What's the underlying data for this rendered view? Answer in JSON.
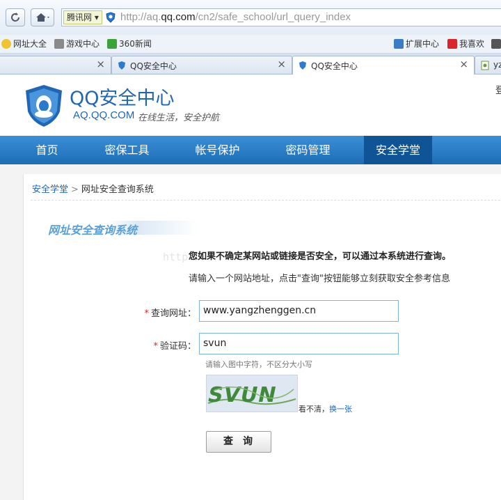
{
  "browser": {
    "site_badge": "腾讯网",
    "url_prefix": "http://aq.",
    "url_domain": "qq.com",
    "url_path": "/cn2/safe_school/url_query_index",
    "bookmarks": [
      "网址大全",
      "游戏中心",
      "360新闻"
    ],
    "bookmarks_right": [
      "扩展中心",
      "我喜欢"
    ],
    "tabs": [
      {
        "title": "",
        "active": false
      },
      {
        "title": "QQ安全中心",
        "active": false
      },
      {
        "title": "QQ安全中心",
        "active": true
      },
      {
        "title": "yz",
        "active": false
      }
    ]
  },
  "site": {
    "title": "QQ安全中心",
    "domain": "AQ.QQ.COM",
    "slogan": "在线生活，安全护航",
    "login_edge": "登",
    "nav": [
      "首页",
      "密保工具",
      "帐号保护",
      "密码管理",
      "安全学堂"
    ],
    "nav_active": "安全学堂"
  },
  "page": {
    "breadcrumb_parent": "安全学堂",
    "breadcrumb_sep": ">",
    "breadcrumb_current": "网址安全查询系统",
    "section_title": "网址安全查询系统",
    "intro_bold": "您如果不确定某网站或链接是否安全，可以通过本系统进行查询。",
    "intro_sub": "请输入一个网站地址，点击\"查询\"按钮能够立刻获取安全参考信息",
    "watermark": "http",
    "form": {
      "url_label": "查询网址：",
      "url_value": "www.yangzhenggen.cn",
      "captcha_label": "验证码：",
      "captcha_value": "svun",
      "captcha_hint": "请输入图中字符，不区分大小写",
      "captcha_image_text": "SVUN",
      "refresh_muted": "看不清，",
      "refresh_link": "换一张",
      "submit_label": "查询"
    }
  },
  "colors": {
    "brand_blue": "#1f66b4",
    "nav_bg": "#2a7fc8",
    "required": "#d9262c"
  }
}
